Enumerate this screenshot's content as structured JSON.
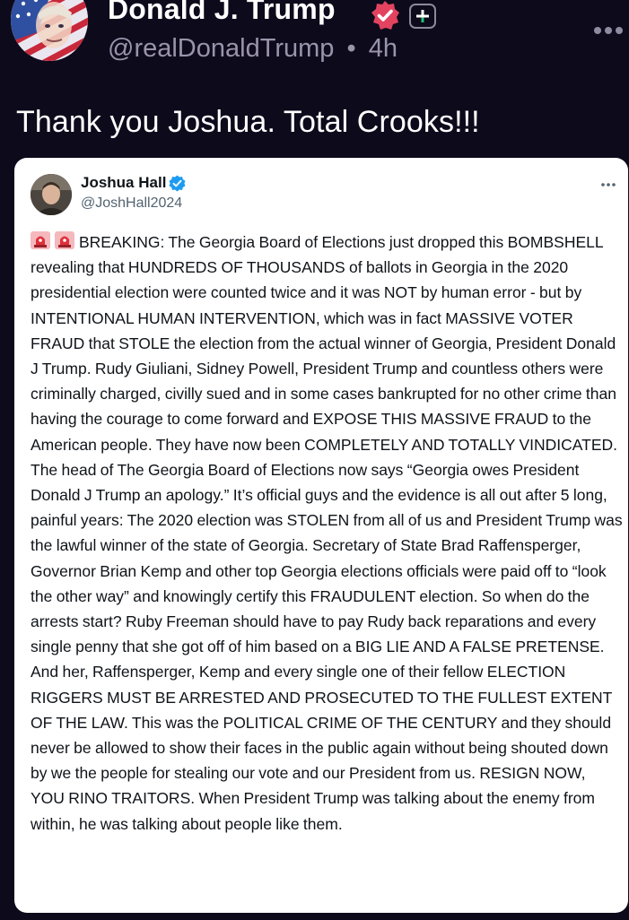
{
  "post": {
    "display_name": "Donald J. Trump",
    "handle": "@realDonaldTrump",
    "separator": "•",
    "time_ago": "4h",
    "text": "Thank you Joshua. Total Crooks!!!"
  },
  "embedded_post": {
    "display_name": "Joshua Hall",
    "handle": "@JoshHall2024",
    "body": "BREAKING: The Georgia Board of Elections just dropped this BOMBSHELL revealing that HUNDREDS OF THOUSANDS of ballots in Georgia in the 2020 presidential election were counted twice and it was NOT by human error - but by INTENTIONAL HUMAN INTERVENTION, which was in fact MASSIVE VOTER FRAUD that STOLE the election from the actual winner of Georgia, President Donald J Trump. Rudy Giuliani, Sidney Powell, President Trump and countless others were criminally charged, civilly sued and in some cases bankrupted for no other crime than having the courage to come forward and EXPOSE THIS MASSIVE FRAUD to the American people. They have now been COMPLETELY AND TOTALLY VINDICATED. The head of The Georgia Board of Elections now says “Georgia owes President Donald J Trump an apology.” It’s official guys and the evidence is all out after 5 long, painful years: The 2020 election was STOLEN from all of us and President Trump was the lawful winner of the state of Georgia. Secretary of State Brad Raffensperger, Governor Brian Kemp and other top Georgia elections officials were paid off to “look the other way” and knowingly certify this FRAUDULENT election. So when do the arrests start? Ruby Freeman should have to pay Rudy back reparations and every single penny that she got off of him based on a BIG LIE AND A FALSE PRETENSE. And her, Raffensperger, Kemp and every single one of their fellow ELECTION RIGGERS MUST BE ARRESTED AND PROSECUTED TO THE FULLEST EXTENT OF THE LAW. This was the POLITICAL CRIME OF THE CENTURY and they should never be allowed to show their faces in the public again without being shouted down by we the people for stealing our vote and our President from us. RESIGN NOW, YOU RINO TRAITORS. When President Trump was talking about the enemy from within, he was talking about people like them."
  },
  "icons": {
    "verified": "verified-badge-icon",
    "plus": "plus-icon",
    "more": "more-icon",
    "siren": "siren-icon"
  },
  "colors": {
    "background": "#0d0a1b",
    "handle_gray": "#9994aa",
    "verified_pink": "#e3435f",
    "embed_verified_blue": "#1d9bf0",
    "siren_red": "#e0303a"
  }
}
